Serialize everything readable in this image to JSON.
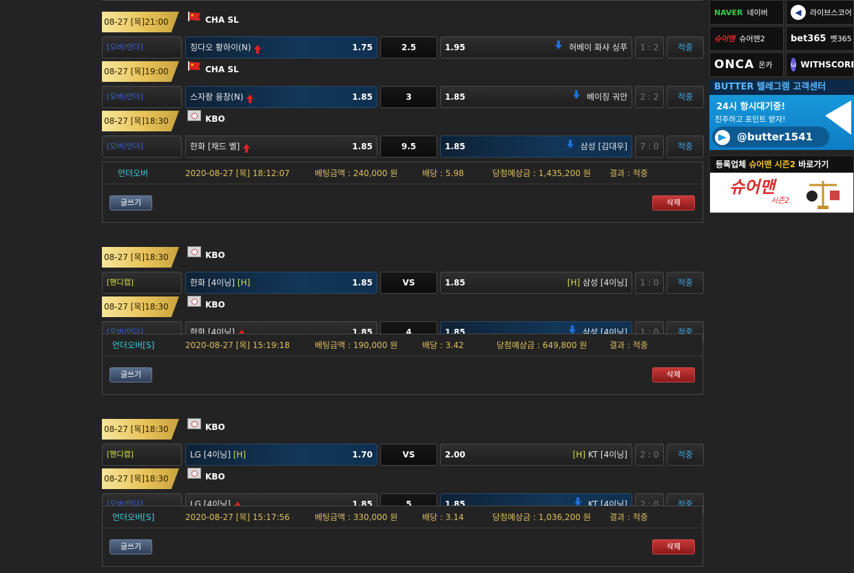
{
  "bets": [
    {
      "games": [
        {
          "date": "08-27 [목]21:00",
          "league": "CHA SL",
          "league_icon": "china-flag-icon",
          "type": "[오버/언더]",
          "type_kind": "ou",
          "home": "칭다오 황하이(N)",
          "home_odd": "1.75",
          "home_sel": true,
          "home_arrow": "up",
          "mid": "2.5",
          "away_odd": "1.95",
          "away": "허베이 화샤 싱푸",
          "away_sel": false,
          "away_arrow": "down",
          "score": "1 : 2",
          "result": "적중"
        },
        {
          "date": "08-27 [목]19:00",
          "league": "CHA SL",
          "league_icon": "china-flag-icon",
          "type": "[오버/언더]",
          "type_kind": "ou",
          "home": "스자좡 융창(N)",
          "home_odd": "1.85",
          "home_sel": true,
          "home_arrow": "up",
          "mid": "3",
          "away_odd": "1.85",
          "away": "베이징 궈안",
          "away_sel": false,
          "away_arrow": "down",
          "score": "2 : 2",
          "result": "적중"
        },
        {
          "date": "08-27 [목]18:30",
          "league": "KBO",
          "league_icon": "baseball-icon",
          "type": "[오버/언더]",
          "type_kind": "ou",
          "home": "한화 [채드 벨]",
          "home_odd": "1.85",
          "home_sel": false,
          "home_arrow": "up",
          "mid": "9.5",
          "away_odd": "1.85",
          "away": "삼성 [김대우]",
          "away_sel": true,
          "away_arrow": "down",
          "score": "7 : 0",
          "result": "적중"
        }
      ],
      "summary": {
        "type": "언더오버",
        "datetime": "2020-08-27 [목] 18:12:07",
        "amount": "베팅금액 : 240,000 원",
        "odds": "배당 : 5.98",
        "win": "당첨예상금 : 1,435,200 원",
        "result": "결과 : 적중",
        "write": "글쓰기",
        "delete": "삭제"
      }
    },
    {
      "games": [
        {
          "date": "08-27 [목]18:30",
          "league": "KBO",
          "league_icon": "baseball-icon",
          "type": "[핸디캡]",
          "type_kind": "hc",
          "home": "한화 [4이닝]",
          "home_h": "[H]",
          "home_odd": "1.85",
          "home_sel": true,
          "home_arrow": "",
          "mid": "VS",
          "away_odd": "1.85",
          "away_h": "[H]",
          "away": "삼성 [4이닝]",
          "away_sel": false,
          "away_arrow": "",
          "score": "1 : 0",
          "result": "적중"
        },
        {
          "date": "08-27 [목]18:30",
          "league": "KBO",
          "league_icon": "baseball-icon",
          "type": "[오버/언더]",
          "type_kind": "ou",
          "home": "한화 [4이닝]",
          "home_odd": "1.85",
          "home_sel": false,
          "home_arrow": "up",
          "mid": "4",
          "away_odd": "1.85",
          "away": "삼성 [4이닝]",
          "away_sel": true,
          "away_arrow": "down",
          "score": "1 : 0",
          "result": "적중"
        }
      ],
      "summary": {
        "type": "언더오버[S]",
        "datetime": "2020-08-27 [목] 15:19:18",
        "amount": "베팅금액 : 190,000 원",
        "odds": "배당 : 3.42",
        "win": "당첨예상금 : 649,800 원",
        "result": "결과 : 적중",
        "write": "글쓰기",
        "delete": "삭제"
      }
    },
    {
      "games": [
        {
          "date": "08-27 [목]18:30",
          "league": "KBO",
          "league_icon": "baseball-icon",
          "type": "[핸디캡]",
          "type_kind": "hc",
          "home": "LG [4이닝]",
          "home_h": "[H]",
          "home_odd": "1.70",
          "home_sel": true,
          "home_arrow": "",
          "mid": "VS",
          "away_odd": "2.00",
          "away_h": "[H]",
          "away": "KT [4이닝]",
          "away_sel": false,
          "away_arrow": "",
          "score": "2 : 0",
          "result": "적중"
        },
        {
          "date": "08-27 [목]18:30",
          "league": "KBO",
          "league_icon": "baseball-icon",
          "type": "[오버/언더]",
          "type_kind": "ou",
          "home": "LG [4이닝]",
          "home_odd": "1.85",
          "home_sel": false,
          "home_arrow": "up",
          "mid": "5",
          "away_odd": "1.85",
          "away": "KT [4이닝]",
          "away_sel": true,
          "away_arrow": "down",
          "score": "2 : 0",
          "result": "적중"
        }
      ],
      "summary": {
        "type": "언더오버[S]",
        "datetime": "2020-08-27 [목] 15:17:56",
        "amount": "베팅금액 : 330,000 원",
        "odds": "배당 : 3.14",
        "win": "당첨예상금 : 1,036,200 원",
        "result": "결과 : 적중",
        "write": "글쓰기",
        "delete": "삭제"
      }
    }
  ],
  "sidebar": {
    "links": [
      {
        "logo": "NAVER",
        "label": "네이버",
        "icon": "naver-logo"
      },
      {
        "logo": "◀",
        "label": "라이브스코어",
        "icon": "livescore-icon"
      },
      {
        "logo": "슈어맨",
        "label": "슈어맨2",
        "icon": "sureman-logo"
      },
      {
        "logo": "bet365",
        "label": "벳365",
        "icon": "bet365-logo"
      },
      {
        "logo": "ONCA",
        "label": "온카",
        "icon": "onca-logo"
      },
      {
        "logo": "ω",
        "label": "WITHSCORE",
        "icon": "withscore-icon"
      }
    ],
    "butter": {
      "header": "BUTTER 텔레그램 고객센터",
      "line1": "24시 항시대기중!",
      "line2": "친추하고 포인트 받자!",
      "handle": "@butter1541"
    },
    "sureman": {
      "header_pre": "등록업체",
      "header_em": "슈어맨 시즌2",
      "header_post": "바로가기",
      "big": "슈어맨",
      "small": "시즌2"
    }
  }
}
